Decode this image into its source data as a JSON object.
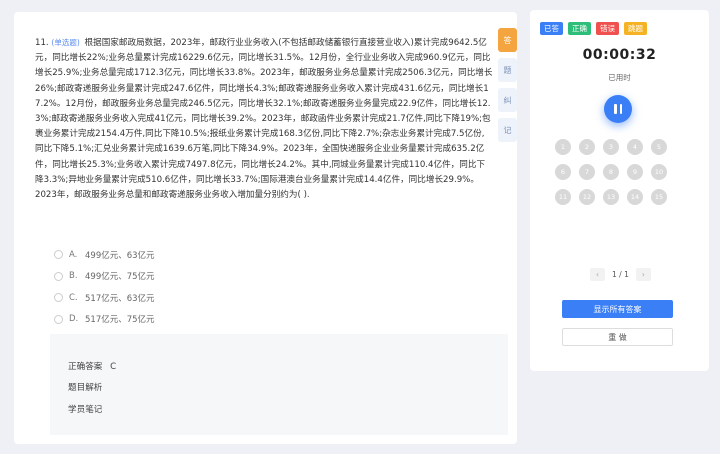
{
  "question": {
    "number": "11.",
    "tag": "(单选题)",
    "text": "根据国家邮政局数据，2023年，邮政行业业务收入(不包括邮政储蓄银行直接营业收入)累计完成9642.5亿元，同比增长22%;业务总量累计完成16229.6亿元，同比增长31.5%。12月份，全行业业务收入完成960.9亿元，同比增长25.9%;业务总量完成1712.3亿元，同比增长33.8%。2023年，邮政服务业务总量累计完成2506.3亿元，同比增长26%;邮政寄递服务业务量累计完成247.6亿件，同比增长4.3%;邮政寄递服务业务收入累计完成431.6亿元，同比增长17.2%。12月份，邮政服务业务总量完成246.5亿元，同比增长32.1%;邮政寄递服务业务量完成22.9亿件，同比增长12.3%;邮政寄递服务业务收入完成41亿元，同比增长39.2%。2023年，邮政函件业务累计完成21.7亿件,同比下降19%;包裹业务累计完成2154.4万件,同比下降10.5%;报纸业务累计完成168.3亿份,同比下降2.7%;杂志业务累计完成7.5亿份,同比下降5.1%;汇兑业务累计完成1639.6万笔,同比下降34.9%。2023年，全国快递服务企业业务量累计完成635.2亿件，同比增长25.3%;业务收入累计完成7497.8亿元，同比增长24.2%。其中,同城业务量累计完成110.4亿件，同比下降3.3%;异地业务量累计完成510.6亿件，同比增长33.7%;国际港澳台业务量累计完成14.4亿件，同比增长29.9%。",
    "prompt": "2023年，邮政服务业务总量和邮政寄递服务业务收入增加量分别约为(    )."
  },
  "options": [
    {
      "letter": "A.",
      "text": "499亿元、63亿元"
    },
    {
      "letter": "B.",
      "text": "499亿元、75亿元"
    },
    {
      "letter": "C.",
      "text": "517亿元、63亿元"
    },
    {
      "letter": "D.",
      "text": "517亿元、75亿元"
    }
  ],
  "analysis": {
    "answer_label": "正确答案",
    "answer_value": "C",
    "explanation_label": "题目解析",
    "notes_label": "学员笔记"
  },
  "side_tabs": [
    {
      "label": "答",
      "icon": "answer-icon"
    },
    {
      "label": "题",
      "icon": "question-icon"
    },
    {
      "label": "纠",
      "icon": "correction-icon"
    },
    {
      "label": "记",
      "icon": "note-icon"
    }
  ],
  "legend": [
    {
      "label": "已答",
      "color": "#3a7ff6"
    },
    {
      "label": "正确",
      "color": "#2dbf7a"
    },
    {
      "label": "错误",
      "color": "#f0514f"
    },
    {
      "label": "跳题",
      "color": "#f5b223"
    }
  ],
  "timer": {
    "value": "00:00:32",
    "label": "已用时"
  },
  "question_numbers": [
    "1",
    "2",
    "3",
    "4",
    "5",
    "6",
    "7",
    "8",
    "9",
    "10",
    "11",
    "12",
    "13",
    "14",
    "15"
  ],
  "pager": {
    "prev": "‹",
    "text": "1 / 1",
    "next": "›"
  },
  "buttons": {
    "show_all": "显示所有答案",
    "redo": "重 做"
  },
  "colors": {
    "accent": "#3a7ff6",
    "tab_active": "#f5a540",
    "pending": "#d8d8d8"
  }
}
